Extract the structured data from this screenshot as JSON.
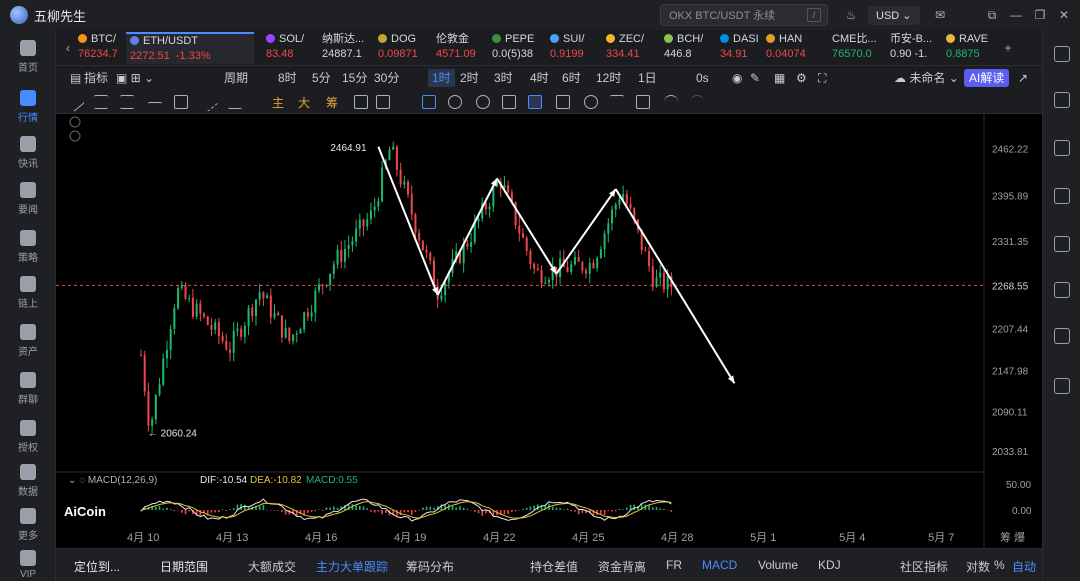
{
  "app": {
    "title": "五柳先生",
    "search_placeholder": "OKX BTC/USDT 永续",
    "search_shortcut": "/",
    "currency": "USD"
  },
  "sidebar": [
    {
      "label": "首页",
      "icon": "home-icon"
    },
    {
      "label": "行情",
      "icon": "chart-icon",
      "active": true
    },
    {
      "label": "快讯",
      "icon": "flash-icon"
    },
    {
      "label": "要闻",
      "icon": "news-icon"
    },
    {
      "label": "策略",
      "icon": "robot-icon"
    },
    {
      "label": "链上",
      "icon": "chain-icon"
    },
    {
      "label": "资产",
      "icon": "wallet-icon"
    },
    {
      "label": "群聊",
      "icon": "chat-icon"
    },
    {
      "label": "授权",
      "icon": "key-icon"
    },
    {
      "label": "数据",
      "icon": "data-icon"
    },
    {
      "label": "更多",
      "icon": "more-icon"
    },
    {
      "label": "VIP",
      "icon": "vip-icon"
    }
  ],
  "tickers": [
    {
      "name": "BTC/",
      "price": "76234.7",
      "dir": "down",
      "dot": "#f7931a"
    },
    {
      "name": "ETH/USDT",
      "price": "2272.51",
      "change": "-1.33%",
      "dir": "down",
      "dot": "#627eea",
      "selected": true
    },
    {
      "name": "SOL/",
      "price": "83.48",
      "dir": "down",
      "dot": "#9945ff"
    },
    {
      "name": "纳斯达...",
      "price": "24887.1",
      "dir": "flat",
      "dot": ""
    },
    {
      "name": "DOG",
      "price": "0.09871",
      "dir": "down",
      "dot": "#c2a633"
    },
    {
      "name": "伦敦金",
      "price": "4571.09",
      "dir": "down",
      "dot": ""
    },
    {
      "name": "PEPE",
      "price": "0.0(5)38",
      "dir": "flat",
      "dot": "#3d8f3d"
    },
    {
      "name": "SUI/",
      "price": "0.9199",
      "dir": "down",
      "dot": "#4da2ff"
    },
    {
      "name": "ZEC/",
      "price": "334.41",
      "dir": "down",
      "dot": "#f4b728"
    },
    {
      "name": "BCH/",
      "price": "446.8",
      "dir": "flat",
      "dot": "#8dc351"
    },
    {
      "name": "DASI",
      "price": "34.91",
      "dir": "down",
      "dot": "#008ce7"
    },
    {
      "name": "HAN",
      "price": "0.04074",
      "dir": "down",
      "dot": "#e0a020"
    },
    {
      "name": "CME比...",
      "price": "76570.0",
      "dir": "up",
      "dot": ""
    },
    {
      "name": "币安-B...",
      "price": "0.90 -1.",
      "dir": "flat",
      "dot": ""
    },
    {
      "name": "RAVE",
      "price": "0.8875",
      "dir": "up",
      "dot": "#e8b73b"
    }
  ],
  "toolbar": {
    "indicator": "指标",
    "period": "周期",
    "intervals": [
      "8时",
      "5分",
      "15分",
      "30分",
      "1时",
      "2时",
      "3时",
      "4时",
      "6时",
      "12时",
      "1日",
      "0s"
    ],
    "selected": "1时",
    "unnamed": "未命名",
    "ai": "AI解读"
  },
  "drawbar": {
    "labels": [
      "主",
      "大",
      "筹"
    ]
  },
  "chart": {
    "y_ticks": [
      "2462.22",
      "2395.89",
      "2331.35",
      "2268.55",
      "2207.44",
      "2147.98",
      "2090.11",
      "2033.81"
    ],
    "x_ticks": [
      "4月 10",
      "4月 13",
      "4月 16",
      "4月 19",
      "4月 22",
      "4月 25",
      "4月 28",
      "5月 1",
      "5月 4",
      "5月 7"
    ],
    "high_label": "2464.91",
    "low_label": "← 2060.24",
    "last_price": "2268.55",
    "macd_label": "MACD(12,26,9)",
    "dif": "DIF:-10.54",
    "dea": "DEA:-10.82",
    "macd": "MACD:0.55",
    "macd_y_ticks": [
      "50.00",
      "0.00"
    ],
    "watermark": "AiCoin",
    "ticks_right": "筹 爆"
  },
  "chart_data": {
    "type": "candlestick",
    "symbol": "ETH/USDT",
    "interval": "1h",
    "high": 2464.91,
    "low": 2060.24,
    "last": 2268.55,
    "ylim": [
      2010,
      2500
    ],
    "x_labels": [
      "4月 10",
      "4月 13",
      "4月 16",
      "4月 19",
      "4月 22",
      "4月 25",
      "4月 28",
      "5月 1",
      "5月 4",
      "5月 7"
    ],
    "annotation_path": [
      {
        "x": "4月 18",
        "y": 2464.9
      },
      {
        "x": "4月 20",
        "y": 2255
      },
      {
        "x": "4月 22",
        "y": 2420
      },
      {
        "x": "4月 24",
        "y": 2285
      },
      {
        "x": "4月 26",
        "y": 2405
      },
      {
        "x": "4月 30",
        "y": 2130
      }
    ]
  },
  "bottom": {
    "items": [
      "定位到...",
      "日期范围",
      "大额成交",
      "主力大单跟踪",
      "筹码分布",
      "持仓差值",
      "资金背离",
      "FR",
      "MACD",
      "Volume",
      "KDJ",
      "社区指标",
      "对数",
      "%",
      "自动"
    ],
    "selected": [
      "主力大单跟踪",
      "MACD",
      "自动"
    ]
  }
}
